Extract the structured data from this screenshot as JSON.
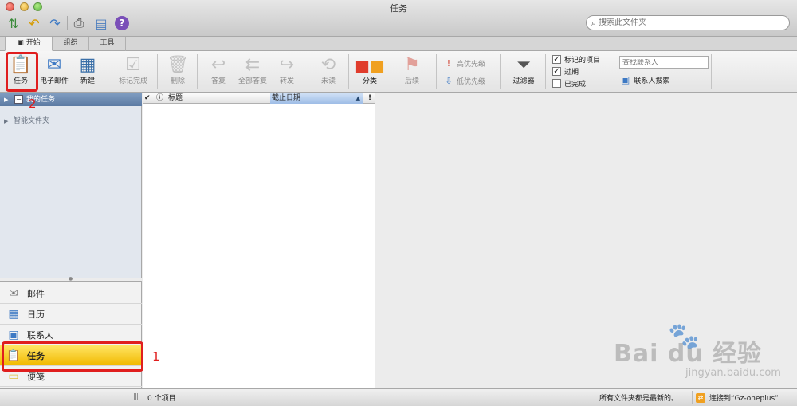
{
  "window": {
    "title": "任务"
  },
  "quick_access": {
    "icons": [
      "send-receive-icon",
      "undo-icon",
      "redo-icon",
      "print-icon",
      "calendar-view-icon",
      "help-icon"
    ],
    "help_glyph": "?"
  },
  "search": {
    "placeholder": "搜索此文件夹"
  },
  "tabs": [
    {
      "label": "开始"
    },
    {
      "label": "组织"
    },
    {
      "label": "工具"
    }
  ],
  "ribbon": {
    "task": "任务",
    "email": "电子邮件",
    "new": "新建",
    "mark_complete": "标记完成",
    "delete": "删除",
    "reply": "答复",
    "reply_all": "全部答复",
    "forward": "转发",
    "unread": "未读",
    "categorize": "分类",
    "follow_up": "后续",
    "high_priority": "高优先级",
    "low_priority": "低优先级",
    "filters": "过滤器",
    "flagged_items": "标记的项目",
    "overdue": "过期",
    "completed": "已完成",
    "find_contact_placeholder": "查找联系人",
    "contact_search": "联系人搜索"
  },
  "filters_state": {
    "flagged_items": true,
    "overdue": true,
    "completed": false
  },
  "folders": {
    "my_tasks": "我的任务",
    "smart_folders": "智能文件夹"
  },
  "nav": {
    "mail": "邮件",
    "calendar": "日历",
    "contacts": "联系人",
    "tasks": "任务",
    "notes": "便笺"
  },
  "table": {
    "title_col": "标题",
    "due_col": "截止日期",
    "priority_col": "!"
  },
  "status": {
    "item_count": "0 个项目",
    "up_to_date": "所有文件夹都是最新的。",
    "connection": "连接到“Gz-oneplus”"
  },
  "annotations": {
    "first": "1",
    "second": "2"
  },
  "watermark": {
    "text": "Bai du 经验",
    "url": "jingyan.baidu.com"
  },
  "colors": {
    "selection_yellow": "#f1b900",
    "annotation_red": "#e01e1e",
    "sidebar_blue": "#e2e7ee"
  }
}
